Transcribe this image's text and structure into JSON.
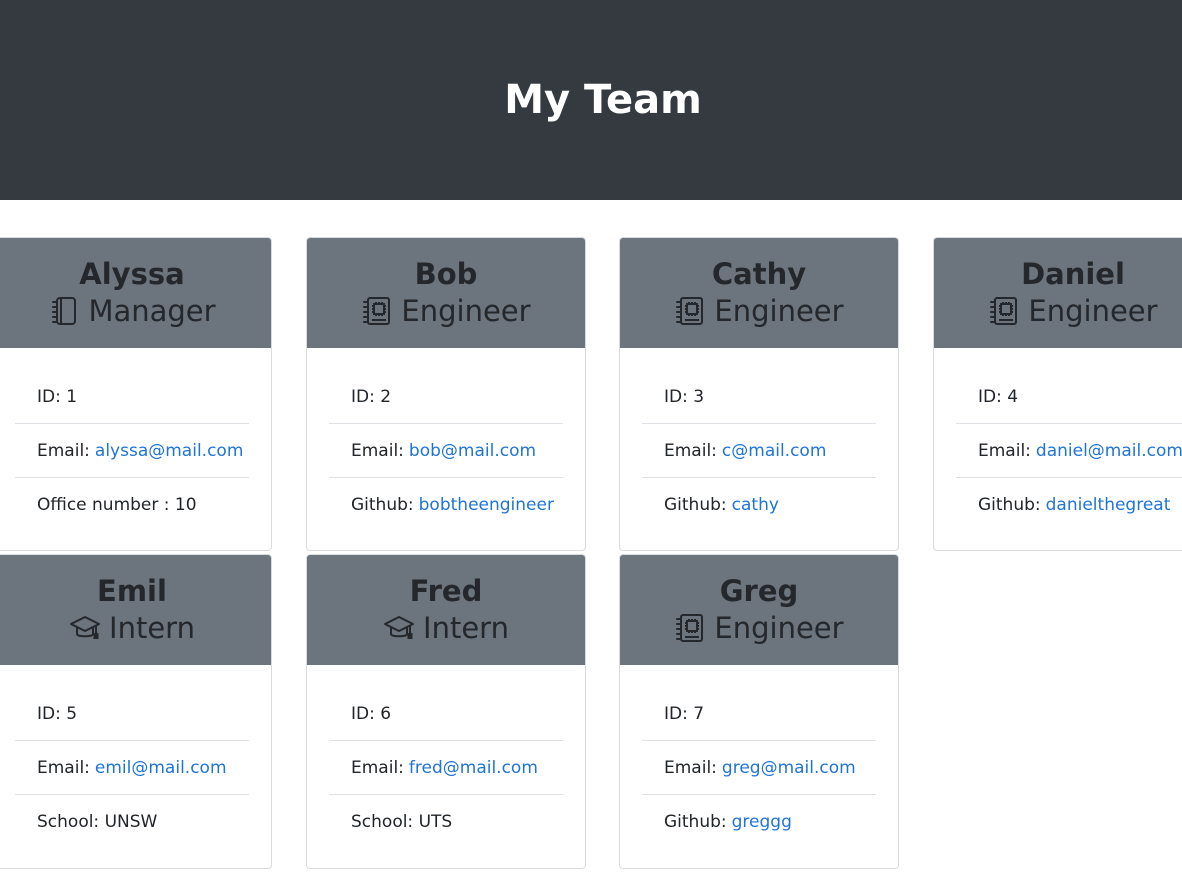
{
  "header": {
    "title": "My Team"
  },
  "cards": [
    {
      "name": "Alyssa",
      "role": "Manager",
      "icon": "notebook-icon",
      "id_label": "ID: 1",
      "email_label": "Email:",
      "email": "alyssa@mail.com",
      "extra_label": "Office number :",
      "extra_value": "10",
      "extra_is_link": false
    },
    {
      "name": "Bob",
      "role": "Engineer",
      "icon": "circuit-book-icon",
      "id_label": "ID: 2",
      "email_label": "Email:",
      "email": "bob@mail.com",
      "extra_label": "Github:",
      "extra_value": "bobtheengineer",
      "extra_is_link": true
    },
    {
      "name": "Cathy",
      "role": "Engineer",
      "icon": "circuit-book-icon",
      "id_label": "ID: 3",
      "email_label": "Email:",
      "email": "c@mail.com",
      "extra_label": "Github:",
      "extra_value": "cathy",
      "extra_is_link": true
    },
    {
      "name": "Daniel",
      "role": "Engineer",
      "icon": "circuit-book-icon",
      "id_label": "ID: 4",
      "email_label": "Email:",
      "email": "daniel@mail.com",
      "extra_label": "Github:",
      "extra_value": "danielthegreat",
      "extra_is_link": true
    },
    {
      "name": "Emil",
      "role": "Intern",
      "icon": "graduation-cap-icon",
      "id_label": "ID: 5",
      "email_label": "Email:",
      "email": "emil@mail.com",
      "extra_label": "School:",
      "extra_value": "UNSW",
      "extra_is_link": false
    },
    {
      "name": "Fred",
      "role": "Intern",
      "icon": "graduation-cap-icon",
      "id_label": "ID: 6",
      "email_label": "Email:",
      "email": "fred@mail.com",
      "extra_label": "School:",
      "extra_value": "UTS",
      "extra_is_link": false
    },
    {
      "name": "Greg",
      "role": "Engineer",
      "icon": "circuit-book-icon",
      "id_label": "ID: 7",
      "email_label": "Email:",
      "email": "greg@mail.com",
      "extra_label": "Github:",
      "extra_value": "greggg",
      "extra_is_link": true
    }
  ],
  "colors": {
    "banner": "#343a40",
    "card_header": "#6c757d",
    "link": "#1f74d9"
  }
}
